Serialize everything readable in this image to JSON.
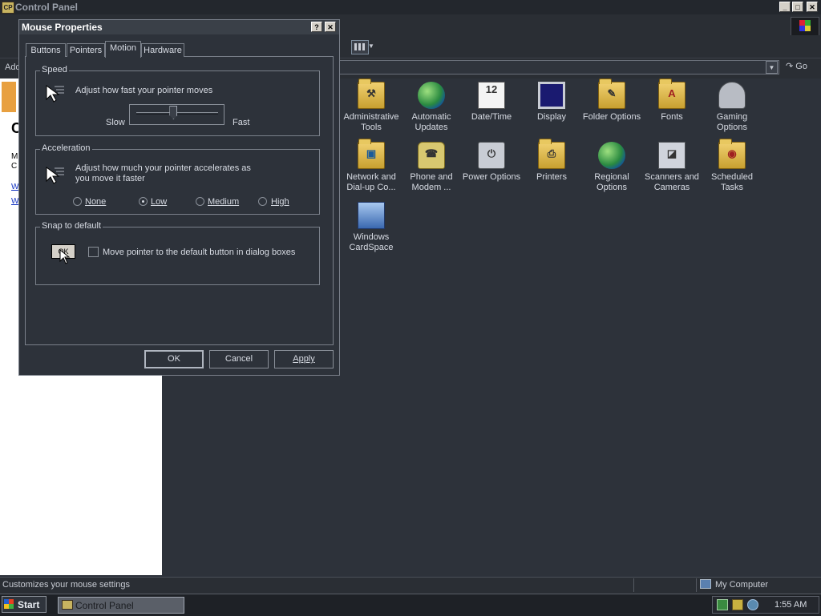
{
  "main_window": {
    "title": "Control Panel",
    "app_icon_label": "CP"
  },
  "window_controls": {
    "minimize": "_",
    "maximize": "□",
    "close": "✕"
  },
  "address_bar": {
    "label": "Add",
    "go_label": "Go",
    "dropdown_glyph": "▼"
  },
  "left_panel": {
    "big_letter": "C",
    "line1": "M",
    "line2": "C",
    "link1": "W",
    "link2": "W"
  },
  "control_panel_items": [
    {
      "label": "Administrative Tools",
      "icon": "administrative-tools-icon"
    },
    {
      "label": "Automatic Updates",
      "icon": "automatic-updates-icon"
    },
    {
      "label": "Date/Time",
      "icon": "date-time-icon"
    },
    {
      "label": "Display",
      "icon": "display-icon"
    },
    {
      "label": "Folder Options",
      "icon": "folder-options-icon"
    },
    {
      "label": "Fonts",
      "icon": "fonts-icon"
    },
    {
      "label": "Gaming Options",
      "icon": "gaming-options-icon"
    },
    {
      "label": "Network and Dial-up Co...",
      "icon": "network-icon"
    },
    {
      "label": "Phone and Modem ...",
      "icon": "phone-modem-icon"
    },
    {
      "label": "Power Options",
      "icon": "power-options-icon"
    },
    {
      "label": "Printers",
      "icon": "printers-icon"
    },
    {
      "label": "Regional Options",
      "icon": "regional-options-icon"
    },
    {
      "label": "Scanners and Cameras",
      "icon": "scanners-cameras-icon"
    },
    {
      "label": "Scheduled Tasks",
      "icon": "scheduled-tasks-icon"
    },
    {
      "label": "Windows CardSpace",
      "icon": "windows-cardspace-icon"
    }
  ],
  "dialog": {
    "title": "Mouse Properties",
    "help_glyph": "?",
    "close_glyph": "✕",
    "tabs": [
      "Buttons",
      "Pointers",
      "Motion",
      "Hardware"
    ],
    "active_tab": "Motion",
    "speed": {
      "group_title": "Speed",
      "description": "Adjust how fast your pointer moves",
      "slow_label": "Slow",
      "fast_label": "Fast",
      "slider_level": 0.45
    },
    "acceleration": {
      "group_title": "Acceleration",
      "description_line1": "Adjust how much your pointer accelerates as",
      "description_line2": "you move it faster",
      "options": [
        "None",
        "Low",
        "Medium",
        "High"
      ],
      "selected": "Low"
    },
    "snap": {
      "group_title": "Snap to default",
      "ok_preview_label": "OK",
      "checkbox_label": "Move pointer to the default button in dialog boxes",
      "checked": false
    },
    "buttons": {
      "ok": "OK",
      "cancel": "Cancel",
      "apply": "Apply"
    }
  },
  "status_bar": {
    "text": "Customizes your mouse settings",
    "zone": "My Computer"
  },
  "taskbar": {
    "start_label": "Start",
    "tasks": [
      "Control Panel"
    ],
    "clock": "1:55 AM"
  }
}
